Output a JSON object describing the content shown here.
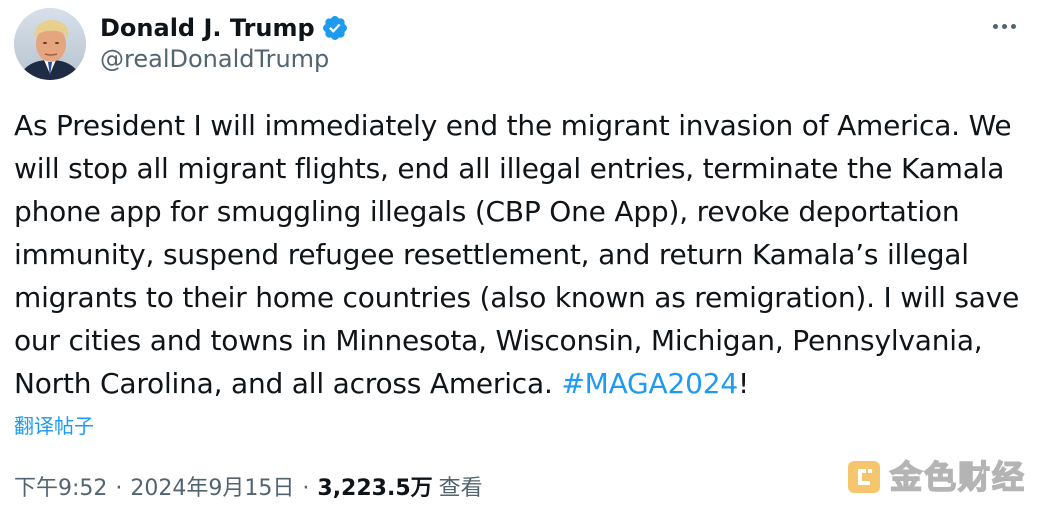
{
  "author": {
    "display_name": "Donald J. Trump",
    "handle": "@realDonaldTrump",
    "verified": true,
    "avatar_icon": "portrait-avatar"
  },
  "tweet": {
    "text_before_hashtag": "As President I will immediately end the migrant invasion of America. We will stop all migrant flights, end all illegal entries, terminate the Kamala phone app for smuggling illegals (CBP One App), revoke deportation immunity, suspend refugee resettlement, and return Kamala’s illegal migrants to their home countries (also known as remigration). I will save our cities and towns in Minnesota, Wisconsin, Michigan, Pennsylvania, North Carolina, and all across America.",
    "hashtag": "#MAGA2024",
    "text_after_hashtag": "!"
  },
  "translate_label": "翻译帖子",
  "meta": {
    "time": "下午9:52",
    "separator": "·",
    "date": "2024年9月15日",
    "views_count": "3,223.5万",
    "views_label": "查看"
  },
  "watermark": {
    "text": "金色财经",
    "icon": "jinse-logo-icon"
  },
  "colors": {
    "link": "#1d9bf0",
    "text": "#0f1419",
    "secondary": "#536471",
    "verified": "#1d9bf0"
  }
}
